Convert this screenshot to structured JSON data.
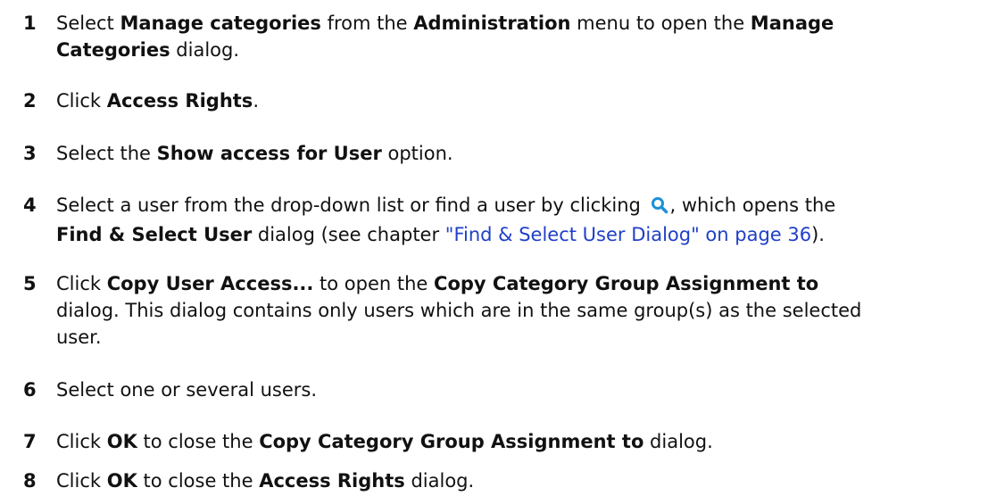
{
  "steps": [
    {
      "number": "1",
      "t1": "Select ",
      "b1": "Manage categories",
      "t2": " from the ",
      "b2": "Administration",
      "t3": " menu to open the ",
      "b3": "Manage",
      "b4": "Categories",
      "t4": " dialog."
    },
    {
      "number": "2",
      "t1": "Click ",
      "b1": "Access Rights",
      "t2": "."
    },
    {
      "number": "3",
      "t1": "Select the ",
      "b1": "Show access for User",
      "t2": " option."
    },
    {
      "number": "4",
      "t1": "Select a user from the drop-down list or find a user by clicking ",
      "icon": "search-icon",
      "t2": ", which opens the",
      "b1": "Find & Select User",
      "t3": " dialog (see chapter ",
      "link": "\"Find & Select User Dialog\" on page 36",
      "t4": ")."
    },
    {
      "number": "5",
      "t1": "Click ",
      "b1": "Copy User Access...",
      "t2": " to open the ",
      "b2": "Copy Category Group Assignment to",
      "t3": "dialog. This dialog contains only users which are in the same group(s) as the selected",
      "t4": "user."
    },
    {
      "number": "6",
      "t1": "Select one or several users."
    },
    {
      "number": "7",
      "t1": "Click ",
      "b1": "OK",
      "t2": " to close the ",
      "b2": "Copy Category Group Assignment to",
      "t3": " dialog."
    },
    {
      "number": "8",
      "t1": "Click ",
      "b1": "OK",
      "t2": " to close the ",
      "b2": "Access Rights",
      "t3": " dialog."
    }
  ],
  "colors": {
    "text": "#111111",
    "link": "#1f3fc8",
    "icon": "#1e90d6"
  }
}
